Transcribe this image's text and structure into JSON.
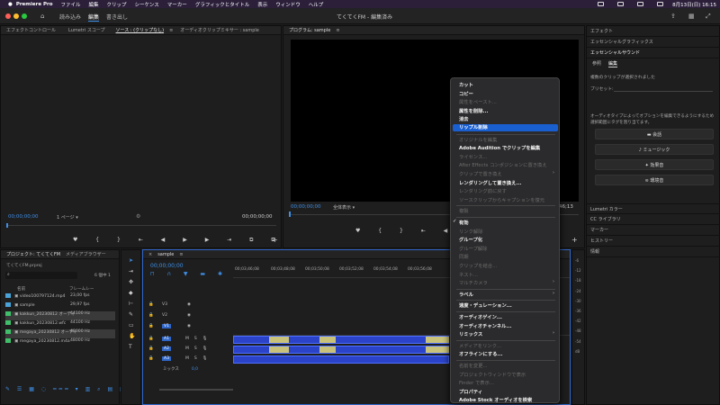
{
  "menubar": {
    "app": "Premiere Pro",
    "items": [
      "ファイル",
      "編集",
      "クリップ",
      "シーケンス",
      "マーカー",
      "グラフィックとタイトル",
      "表示",
      "ウィンドウ",
      "ヘルプ"
    ],
    "datetime": "8月13日(日) 16:15"
  },
  "titlebar": {
    "tabs": [
      "読み込み",
      "編集",
      "書き出し"
    ],
    "window_title": "てくてくFM - 編集済み"
  },
  "source_panel": {
    "tabs": [
      "エフェクトコントロール",
      "Lumetri スコープ",
      "ソース : (クリップなし)",
      "オーディオクリップミキサー : sample"
    ],
    "timecode_left": "00;00;00;00",
    "fit": "1 ページ",
    "timecode_right": "00;00;00;00"
  },
  "program_panel": {
    "title": "プログラム: sample",
    "timecode": "00;00;00;00",
    "fit": "全体表示",
    "duration": "46;13"
  },
  "project_panel": {
    "tabs": [
      "プロジェクト: てくてくFM",
      "メディアブラウザー"
    ],
    "file": "てくてくFM.prproj",
    "count": "6 個中 1",
    "columns": [
      "名前",
      "フレームレー"
    ],
    "rows": [
      {
        "name": "video100797124.mp4",
        "rate": "23,00 fps",
        "color": "#4aa3d8"
      },
      {
        "name": "sample",
        "rate": "29,97 fps",
        "color": "#4aa3d8"
      },
      {
        "name": "kakkun_20230812 オーディ",
        "rate": "44100 Hz",
        "color": "#3fbf6a"
      },
      {
        "name": "kakkun_20230812.wfc",
        "rate": "44100 Hz",
        "color": "#3fbf6a"
      },
      {
        "name": "megaya_20230812 オーディ",
        "rate": "48000 Hz",
        "color": "#3fbf6a"
      },
      {
        "name": "megaya_20230812.m4a",
        "rate": "48000 Hz",
        "color": "#3fbf6a"
      }
    ]
  },
  "timeline": {
    "tab": "sample",
    "timecode": "00;00;00;00",
    "ruler": [
      "00;03;46;08",
      "00;03;48;08",
      "00;03;50;08",
      "00;03;52;08",
      "00;03;54;08",
      "00;03;56;08",
      "00;03;58;08"
    ],
    "video_tracks": [
      "V3",
      "V2",
      "V1"
    ],
    "audio_tracks": [
      "A1",
      "A2",
      "A3"
    ],
    "mix_label": "ミックス",
    "mix_value": "0,0"
  },
  "context_menu": {
    "items": [
      {
        "label": "カット",
        "state": "en"
      },
      {
        "label": "コピー",
        "state": "en"
      },
      {
        "label": "属性をペースト...",
        "state": "dis"
      },
      {
        "label": "属性を削除...",
        "state": "en"
      },
      {
        "label": "消去",
        "state": "en"
      },
      {
        "label": "リップル削除",
        "state": "sel"
      },
      {
        "label": "オリジナルを編集",
        "state": "dis",
        "sep_before": true
      },
      {
        "label": "Adobe Audition でクリップを編集",
        "state": "en"
      },
      {
        "label": "ライセンス...",
        "state": "dis"
      },
      {
        "label": "After Effects コンポジションに置き換え",
        "state": "dis"
      },
      {
        "label": "クリップで置き換え",
        "state": "dis",
        "arrow": true
      },
      {
        "label": "レンダリングして置き換え...",
        "state": "en"
      },
      {
        "label": "レンダリング前に戻す",
        "state": "dis"
      },
      {
        "label": "ソースクリップからキャプションを復元",
        "state": "dis"
      },
      {
        "label": "複製",
        "state": "dis",
        "sep_before": true
      },
      {
        "label": "有効",
        "state": "en",
        "check": true,
        "sep_before": true
      },
      {
        "label": "リンク解除",
        "state": "dis"
      },
      {
        "label": "グループ化",
        "state": "en"
      },
      {
        "label": "グループ解除",
        "state": "dis"
      },
      {
        "label": "同期",
        "state": "dis"
      },
      {
        "label": "クリップを結合...",
        "state": "dis"
      },
      {
        "label": "ネスト...",
        "state": "dis"
      },
      {
        "label": "マルチカメラ",
        "state": "dis",
        "arrow": true
      },
      {
        "label": "ラベル",
        "state": "en",
        "arrow": true,
        "sep_before": true
      },
      {
        "label": "速度・デュレーション...",
        "state": "en",
        "sep_before": true
      },
      {
        "label": "オーディオゲイン...",
        "state": "en",
        "sep_before": true
      },
      {
        "label": "オーディオチャンネル...",
        "state": "en"
      },
      {
        "label": "リミックス",
        "state": "en",
        "arrow": true
      },
      {
        "label": "メディアをリンク...",
        "state": "dis",
        "sep_before": true
      },
      {
        "label": "オフラインにする...",
        "state": "en"
      },
      {
        "label": "名前を変更...",
        "state": "dis",
        "sep_before": true
      },
      {
        "label": "プロジェクトウィンドウで表示",
        "state": "dis"
      },
      {
        "label": "Finder で表示...",
        "state": "dis"
      },
      {
        "label": "プロパティ",
        "state": "en"
      },
      {
        "label": "Adobe Stock オーディオを検索",
        "state": "en"
      }
    ]
  },
  "right_panel": {
    "top_items": [
      "エフェクト",
      "エッセンシャルグラフィックス",
      "エッセンシャルサウンド"
    ],
    "tabs": [
      "参照",
      "編集"
    ],
    "selection_text": "複数のクリップが選択されました",
    "preset_label": "プリセット:",
    "instruction": "オーディオタイプによってオプションを編集できるようにするため選択範囲にタグを割り当てます。",
    "buttons": [
      "会話",
      "ミュージック",
      "効果音",
      "環境音"
    ],
    "bottom_items": [
      "Lumetri カラー",
      "CC ライブラリ",
      "マーカー",
      "ヒストリー",
      "情報"
    ]
  },
  "meter_labels": [
    "-6",
    "-12",
    "-18",
    "-24",
    "-30",
    "-36",
    "-42",
    "-48",
    "-54",
    "dB"
  ]
}
